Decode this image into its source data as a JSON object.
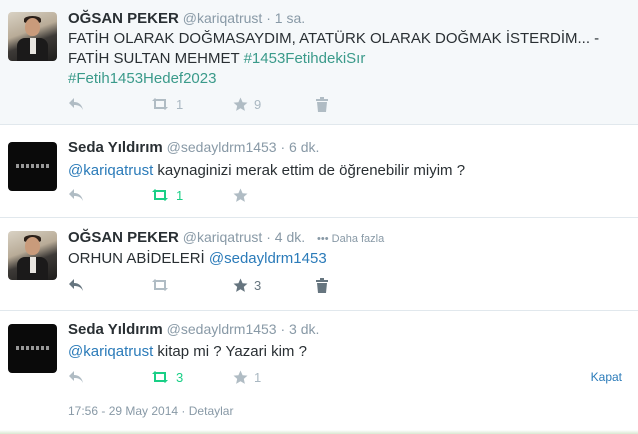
{
  "tweets": [
    {
      "name": "OĞSAN PEKER",
      "handle": "@kariqatrust",
      "dot": "·",
      "time": "1 sa.",
      "text_plain": "FATİH OLARAK DOĞMASAYDIM, ATATÜRK OLARAK DOĞMAK İSTERDİM...  -FATİH SULTAN MEHMET ",
      "hashtag1": "#1453FetihdekiSır",
      "hashtag2": "#Fetih1453Hedef2023",
      "retweets": "1",
      "favorites": "9"
    },
    {
      "name": "Seda Yıldırım",
      "handle": "@sedayldrm1453",
      "dot": "·",
      "time": "6 dk.",
      "mention": "@kariqatrust",
      "text_plain": "  kaynaginizi merak ettim de öğrenebilir miyim ?",
      "retweets": "1"
    },
    {
      "name": "OĞSAN PEKER",
      "handle": "@kariqatrust",
      "dot": "·",
      "time": "4 dk.",
      "more": "••• Daha fazla",
      "text_plain": "ORHUN ABİDELERİ ",
      "mention": "@sedayldrm1453",
      "favorites": "3"
    },
    {
      "name": "Seda Yıldırım",
      "handle": "@sedayldrm1453",
      "dot": "·",
      "time": "3 dk.",
      "mention": "@kariqatrust",
      "text_plain": " kitap mi ? Yazari kim ?",
      "retweets": "3",
      "favorites": "1",
      "close_label": "Kapat"
    }
  ],
  "footer": {
    "timestamp": "17:56 - 29 May 2014",
    "dot": "·",
    "details": "Detaylar"
  },
  "colors": {
    "link": "#2b7bb9",
    "hashtag": "#3a9a8a",
    "retweet_active": "#19cf86",
    "muted": "#8899a6"
  }
}
